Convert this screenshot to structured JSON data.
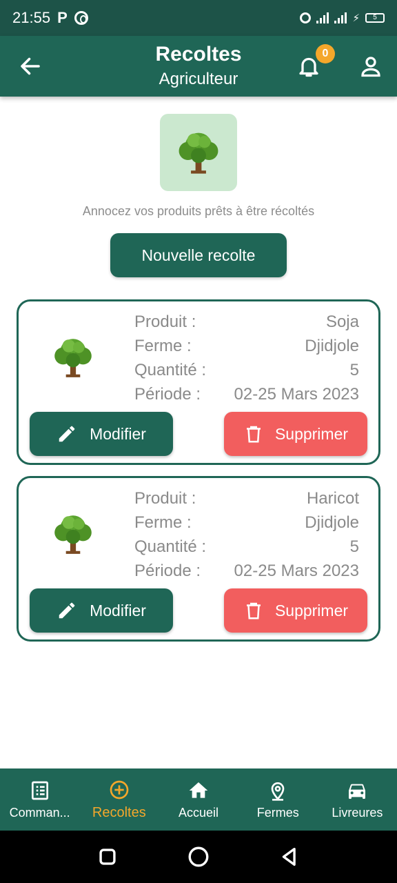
{
  "status_bar": {
    "time": "21:55",
    "battery": "5"
  },
  "app_bar": {
    "title": "Recoltes",
    "subtitle": "Agriculteur",
    "notification_count": "0"
  },
  "hero": {
    "caption": "Annocez vos produits prêts à être récoltés",
    "new_button": "Nouvelle recolte"
  },
  "labels": {
    "product": "Produit :",
    "farm": "Ferme :",
    "quantity": "Quantité :",
    "period": "Période :",
    "modify": "Modifier",
    "delete": "Supprimer"
  },
  "harvests": [
    {
      "product": "Soja",
      "farm": "Djidjole",
      "quantity": "5",
      "period": "02-25 Mars 2023"
    },
    {
      "product": "Haricot",
      "farm": "Djidjole",
      "quantity": "5",
      "period": "02-25 Mars 2023"
    }
  ],
  "bottom_nav": [
    {
      "label": "Comman...",
      "icon": "list-icon",
      "active": false
    },
    {
      "label": "Recoltes",
      "icon": "add-circle-icon",
      "active": true
    },
    {
      "label": "Accueil",
      "icon": "home-icon",
      "active": false
    },
    {
      "label": "Fermes",
      "icon": "location-pin-icon",
      "active": false
    },
    {
      "label": "Livreures",
      "icon": "car-icon",
      "active": false
    }
  ],
  "colors": {
    "primary": "#1f6656",
    "status_bar": "#1d5348",
    "accent": "#f4a72b",
    "danger": "#f25e5e",
    "hero_tile": "#cbe8cf"
  }
}
